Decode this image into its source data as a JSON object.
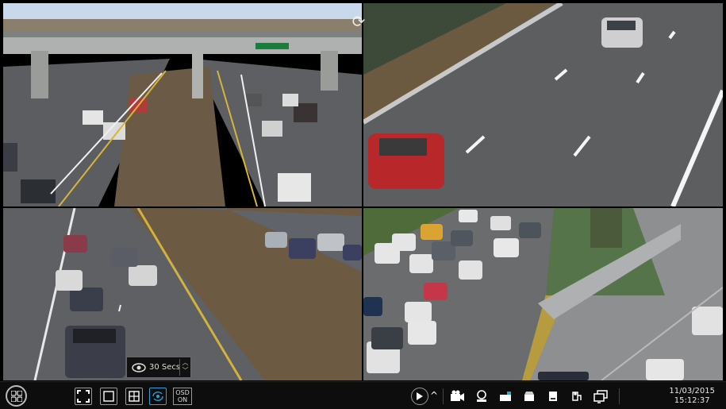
{
  "sequence": {
    "interval_value": "30 Secs"
  },
  "toolbar": {
    "osd_label_line1": "OSD",
    "osd_label_line2": "ON"
  },
  "clock": {
    "date": "11/03/2015",
    "time": "15:12:37"
  },
  "colors": {
    "toolbar_bg": "#0d0d0d",
    "accent": "#2fa0d8"
  },
  "icons": [
    "menu-icon",
    "fullscreen-icon",
    "single-view-icon",
    "quad-view-icon",
    "sequence-icon",
    "play-icon",
    "chevron-up-icon",
    "manual-record-icon",
    "audio-icon",
    "snapshot-icon",
    "disk-icon",
    "backup-icon",
    "ptz-icon",
    "preview-icon",
    "refresh-icon",
    "eye-icon"
  ]
}
